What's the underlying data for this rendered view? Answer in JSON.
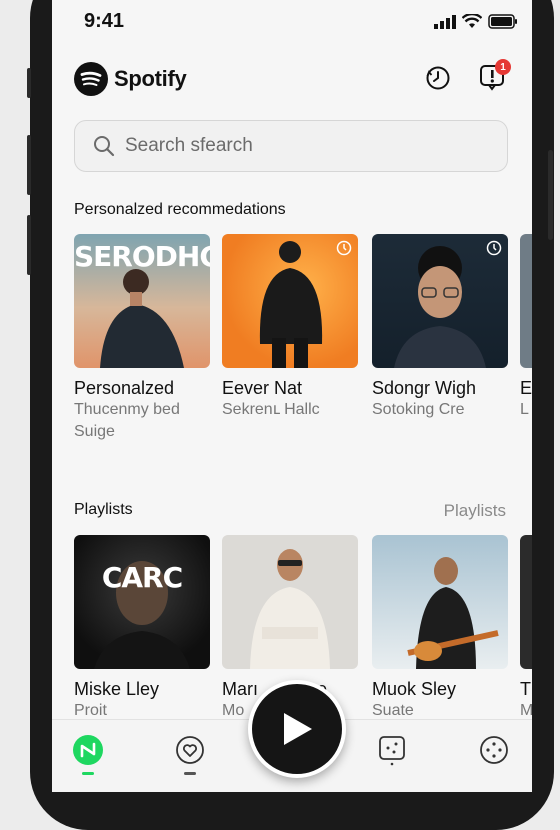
{
  "status_bar": {
    "time": "9:41"
  },
  "header": {
    "app_name": "Spotify",
    "notification_count": "1"
  },
  "search": {
    "placeholder": "Search sfearch"
  },
  "recommendations": {
    "title": "Personalzed recommedations",
    "items": [
      {
        "art_text": "SERODHCK",
        "title": "Personalzed",
        "subtitle": "Thucenmy bed Suige",
        "color": "#d9b08c"
      },
      {
        "title": "Eever Nat",
        "subtitle": "Sekrenւ Hallc",
        "color": "#f08a2c"
      },
      {
        "title": "Sdongr Wigh",
        "subtitle": "Sotoking Cre",
        "color": "#1b2733"
      },
      {
        "title": "E",
        "subtitle": "L",
        "color": "#6f7c86"
      }
    ]
  },
  "playlists": {
    "title": "Playlists",
    "link": "Playlists",
    "items": [
      {
        "art_text": "CARC",
        "title": "Miske Lley",
        "subtitle": "Proit",
        "color": "#1a1a1a"
      },
      {
        "title": "Marı",
        "title_suffix": "live",
        "subtitle": "Mo",
        "color": "#d8d6d2"
      },
      {
        "title": "Muok Sley",
        "subtitle": "Suate",
        "color": "#9ab6c6"
      },
      {
        "title": "T",
        "subtitle": "M",
        "color": "#2b2b2b"
      }
    ]
  },
  "tabbar": {
    "active_color": "#1ed760"
  }
}
